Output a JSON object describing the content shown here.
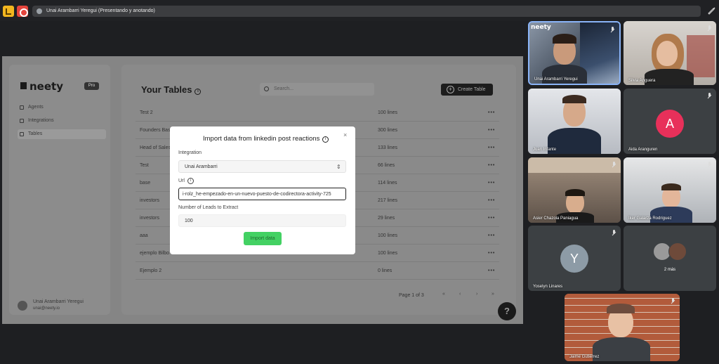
{
  "topbar": {
    "presenting_text": "Unai Arambarri Yeregui (Presentando y anotando)"
  },
  "app": {
    "logo": "neety",
    "plan_badge": "Pro",
    "nav": [
      {
        "label": "Agents"
      },
      {
        "label": "Integrations"
      },
      {
        "label": "Tables"
      }
    ],
    "user": {
      "name": "Unai Arambarri Yeregui",
      "email": "unai@neety.io"
    },
    "title": "Your Tables",
    "search_placeholder": "Search...",
    "create_button": "Create Table",
    "tables": [
      {
        "name": "Test 2",
        "lines": "100 lines"
      },
      {
        "name": "Founders Bas",
        "lines": "300 lines"
      },
      {
        "name": "Head of Sales",
        "lines": "133 lines"
      },
      {
        "name": "Test",
        "lines": "66 lines"
      },
      {
        "name": "base",
        "lines": "114 lines"
      },
      {
        "name": "investors",
        "lines": "217 lines"
      },
      {
        "name": "investors",
        "lines": "29 lines"
      },
      {
        "name": "aaa",
        "lines": "100 lines"
      },
      {
        "name": "ejemplo Bilbo",
        "lines": "100 lines"
      },
      {
        "name": "Ejemplo 2",
        "lines": "0 lines"
      }
    ],
    "more_glyph": "•••",
    "pagination": "Page 1 of 3",
    "help": "?"
  },
  "modal": {
    "title": "Import data from linkedin post reactions",
    "close": "×",
    "integration_label": "Integration",
    "integration_value": "Unai Arambarri",
    "url_label": "Url",
    "url_value": "i-rolz_he-empezado-en-un-nuevo-puesto-de-codirectora-activity-725",
    "leads_label": "Number of Leads to Extract",
    "leads_value": "100",
    "import_button": "Import data"
  },
  "participants": [
    {
      "name": "Unai Arambarri Yeregui",
      "overlay": "neety"
    },
    {
      "name": "Silvia Anguera"
    },
    {
      "name": "Juan Infante"
    },
    {
      "name": "Aida Aranguren",
      "initial": "A",
      "color": "#e8305a"
    },
    {
      "name": "Asier Chazola Paniagua"
    },
    {
      "name": "Iker Galarza Rodriguez"
    },
    {
      "name": "Yoselyn Linares",
      "initial": "Y",
      "color": "#8d9ba6"
    },
    {
      "name": "2 más"
    },
    {
      "name": "Jaime Gutiérrez"
    }
  ]
}
